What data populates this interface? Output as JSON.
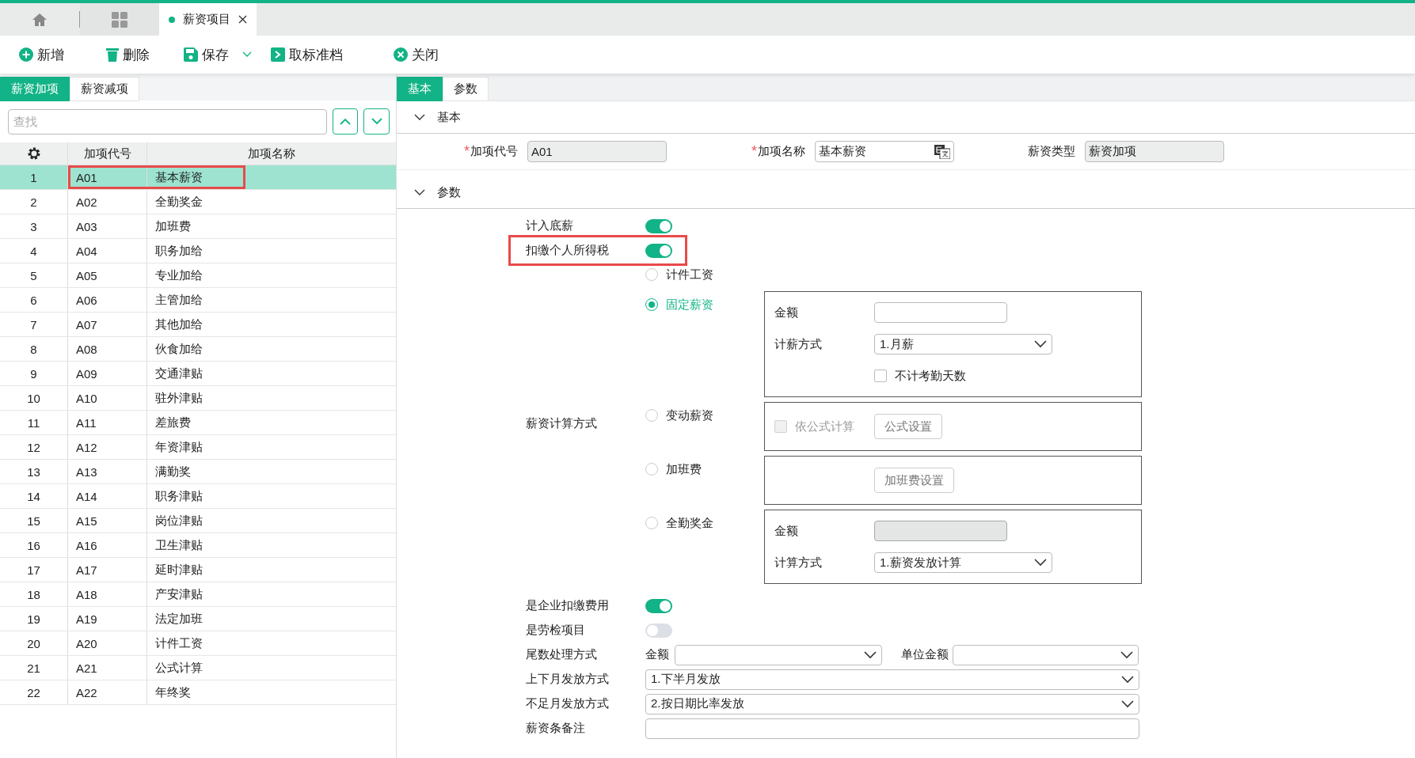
{
  "tab_bar": {
    "tabs": [
      {
        "kind": "home",
        "selected": false
      },
      {
        "kind": "apps",
        "selected": false
      },
      {
        "kind": "page",
        "label": "薪资项目",
        "selected": true
      }
    ]
  },
  "toolbar": [
    {
      "kind": "add",
      "label": "新增",
      "dropdown": false
    },
    {
      "kind": "delete",
      "label": "删除",
      "dropdown": false
    },
    {
      "kind": "save",
      "label": "保存",
      "dropdown": true
    },
    {
      "kind": "archive",
      "label": "取标准档",
      "dropdown": false
    },
    {
      "kind": "close",
      "label": "关闭",
      "dropdown": false
    }
  ],
  "left_panel": {
    "tabs": [
      {
        "label": "薪资加项",
        "selected": true
      },
      {
        "label": "薪资减项",
        "selected": false
      }
    ],
    "search": {
      "placeholder": "查找"
    },
    "table": {
      "columns": [
        "加项代号",
        "加项名称"
      ],
      "rows": [
        {
          "index": "1",
          "code": "A01",
          "name": "基本薪资",
          "selected": true,
          "highlighted": true
        },
        {
          "index": "2",
          "code": "A02",
          "name": "全勤奖金",
          "selected": false,
          "highlighted": false
        },
        {
          "index": "3",
          "code": "A03",
          "name": "加班费",
          "selected": false,
          "highlighted": false
        },
        {
          "index": "4",
          "code": "A04",
          "name": "职务加给",
          "selected": false,
          "highlighted": false
        },
        {
          "index": "5",
          "code": "A05",
          "name": "专业加给",
          "selected": false,
          "highlighted": false
        },
        {
          "index": "6",
          "code": "A06",
          "name": "主管加给",
          "selected": false,
          "highlighted": false
        },
        {
          "index": "7",
          "code": "A07",
          "name": "其他加给",
          "selected": false,
          "highlighted": false
        },
        {
          "index": "8",
          "code": "A08",
          "name": "伙食加给",
          "selected": false,
          "highlighted": false
        },
        {
          "index": "9",
          "code": "A09",
          "name": "交通津贴",
          "selected": false,
          "highlighted": false
        },
        {
          "index": "10",
          "code": "A10",
          "name": "驻外津贴",
          "selected": false,
          "highlighted": false
        },
        {
          "index": "11",
          "code": "A11",
          "name": "差旅费",
          "selected": false,
          "highlighted": false
        },
        {
          "index": "12",
          "code": "A12",
          "name": "年资津贴",
          "selected": false,
          "highlighted": false
        },
        {
          "index": "13",
          "code": "A13",
          "name": "满勤奖",
          "selected": false,
          "highlighted": false
        },
        {
          "index": "14",
          "code": "A14",
          "name": "职务津贴",
          "selected": false,
          "highlighted": false
        },
        {
          "index": "15",
          "code": "A15",
          "name": "岗位津贴",
          "selected": false,
          "highlighted": false
        },
        {
          "index": "16",
          "code": "A16",
          "name": "卫生津贴",
          "selected": false,
          "highlighted": false
        },
        {
          "index": "17",
          "code": "A17",
          "name": "延时津贴",
          "selected": false,
          "highlighted": false
        },
        {
          "index": "18",
          "code": "A18",
          "name": "产安津贴",
          "selected": false,
          "highlighted": false
        },
        {
          "index": "19",
          "code": "A19",
          "name": "法定加班",
          "selected": false,
          "highlighted": false
        },
        {
          "index": "20",
          "code": "A20",
          "name": "计件工资",
          "selected": false,
          "highlighted": false
        },
        {
          "index": "21",
          "code": "A21",
          "name": "公式计算",
          "selected": false,
          "highlighted": false
        },
        {
          "index": "22",
          "code": "A22",
          "name": "年终奖",
          "selected": false,
          "highlighted": false
        }
      ]
    }
  },
  "right_panel": {
    "tabs": [
      {
        "label": "基本",
        "selected": true
      },
      {
        "label": "参数",
        "selected": false
      }
    ],
    "basic": {
      "title": "基本",
      "expanded": true,
      "fields": [
        {
          "kind": "readonly",
          "required_mark": "*",
          "label": "加项代号",
          "value": "A01"
        },
        {
          "kind": "translatable",
          "required_mark": "*",
          "label": "加项名称",
          "value": "基本薪资"
        },
        {
          "kind": "readonly",
          "label": "薪资类型",
          "value": "薪资加项"
        }
      ]
    },
    "params": {
      "title": "参数",
      "expanded": true,
      "toggles_top": [
        {
          "label": "计入底薪",
          "on": true,
          "highlighted": false
        },
        {
          "label": "扣缴个人所得税",
          "on": true,
          "highlighted": true
        }
      ],
      "calc_method": {
        "label": "薪资计算方式",
        "options": [
          {
            "label": "计件工资",
            "selected": false
          },
          {
            "label": "固定薪资",
            "selected": true,
            "panel": {
              "amount": {
                "label": "金额",
                "disabled": false
              },
              "method": {
                "label": "计薪方式",
                "value": "1.月薪"
              },
              "checkbox": {
                "label": "不计考勤天数",
                "checked": false,
                "disabled": false
              }
            }
          },
          {
            "label": "变动薪资",
            "selected": false,
            "panel": {
              "checkbox": {
                "label": "依公式计算",
                "checked": false,
                "disabled": true
              },
              "button": "公式设置"
            }
          },
          {
            "label": "加班费",
            "selected": false,
            "panel": {
              "button": "加班费设置"
            }
          },
          {
            "label": "全勤奖金",
            "selected": false,
            "panel": {
              "amount": {
                "label": "金额",
                "disabled": true
              },
              "method": {
                "label": "计算方式",
                "value": "1.薪资发放计算"
              }
            }
          }
        ]
      },
      "toggles_bottom": [
        {
          "label": "是企业扣缴费用",
          "on": true,
          "highlighted": false
        },
        {
          "label": "是劳检项目",
          "on": false,
          "highlighted": false
        }
      ],
      "rounding": {
        "label": "尾数处理方式",
        "amount_label": "金额",
        "unit_label": "单位金额"
      },
      "month_split": {
        "label": "上下月发放方式",
        "value": "1.下半月发放"
      },
      "partial_month": {
        "label": "不足月发放方式",
        "value": "2.按日期比率发放"
      },
      "remark": {
        "label": "薪资条备注"
      }
    }
  }
}
